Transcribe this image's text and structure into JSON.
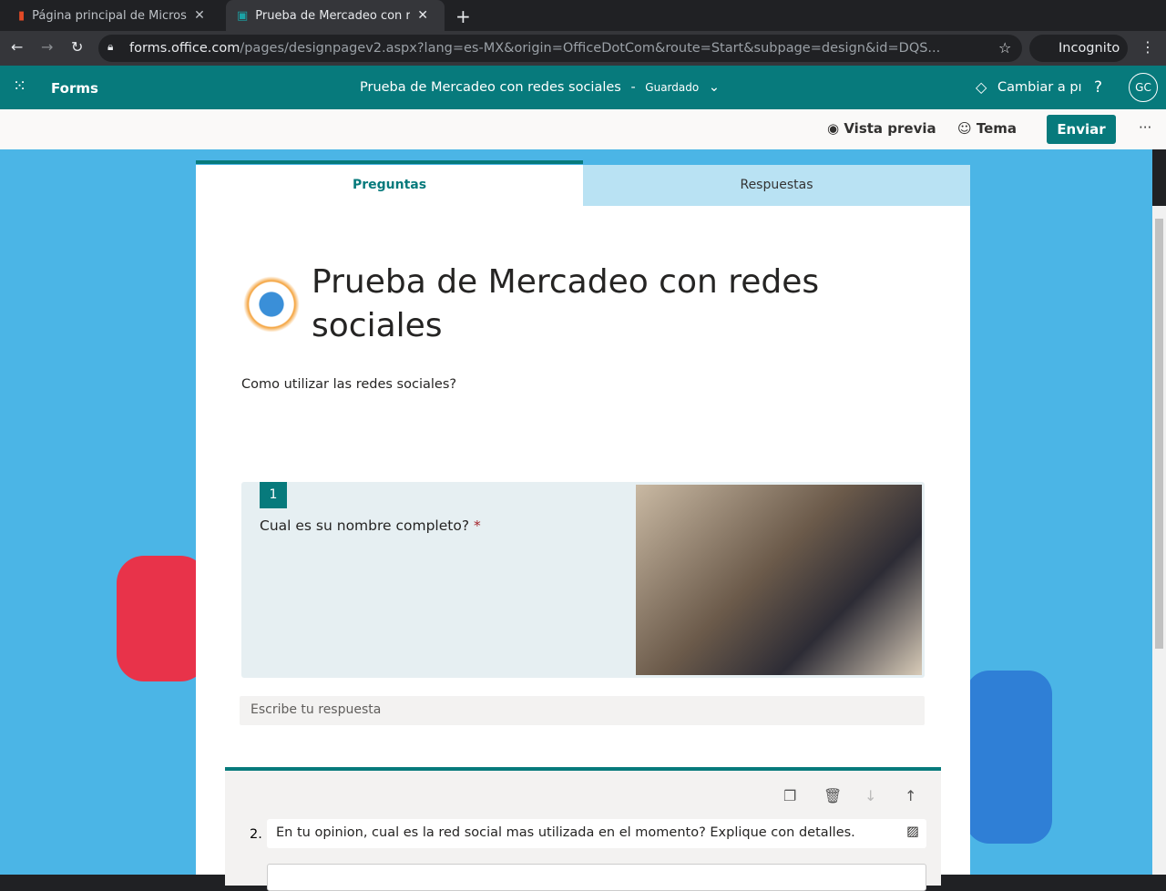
{
  "browser": {
    "tabs": [
      {
        "title": "Página principal de Microsoft"
      },
      {
        "title": "Prueba de Mercadeo con redes sociales"
      }
    ],
    "url_domain": "forms.office.com",
    "url_path": "/pages/designpagev2.aspx?lang=es-MX&origin=OfficeDotCom&route=Start&subpage=design&id=DQS...",
    "incognito": "Incognito"
  },
  "app": {
    "name": "Forms",
    "form_title": "Prueba de Mercadeo con redes sociales",
    "sep": "-",
    "status": "Guardado",
    "upgrade": "Cambiar a pı",
    "help": "?",
    "avatar": "GC"
  },
  "commands": {
    "preview": "Vista previa",
    "theme": "Tema",
    "send": "Enviar",
    "more": "···"
  },
  "tabs": {
    "questions": "Preguntas",
    "responses": "Respuestas"
  },
  "form": {
    "title": "Prueba de Mercadeo con redes sociales",
    "description": "Como utilizar las redes sociales?"
  },
  "questions": [
    {
      "number": "1",
      "text": "Cual es su nombre completo?",
      "required": "*",
      "placeholder": "Escribe tu respuesta"
    },
    {
      "number": "2.",
      "text": "En tu opinion, cual es la red social mas utilizada en el momento? Explique con detalles."
    }
  ],
  "colors": {
    "accent": "#077a7c",
    "background": "#4bb5e6"
  }
}
